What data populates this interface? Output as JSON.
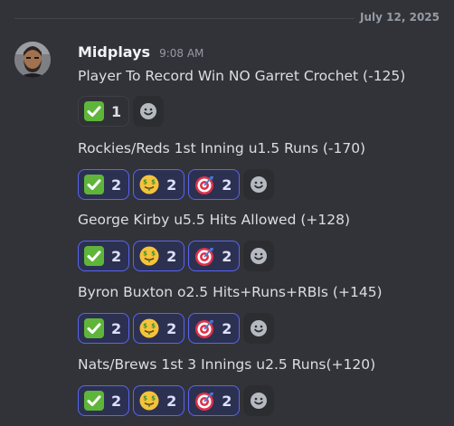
{
  "date_divider": "July 12, 2025",
  "message": {
    "author": "Midplays",
    "time": "9:08 AM"
  },
  "picks": [
    {
      "text": "Player To Record Win NO Garret Crochet (-125)",
      "reactions": [
        {
          "emoji": "check-mark-icon",
          "count": "1",
          "active": false
        }
      ]
    },
    {
      "text": "Rockies/Reds 1st Inning u1.5 Runs (-170)",
      "reactions": [
        {
          "emoji": "check-mark-icon",
          "count": "2",
          "active": true
        },
        {
          "emoji": "money-mouth-face-icon",
          "count": "2",
          "active": true
        },
        {
          "emoji": "direct-hit-icon",
          "count": "2",
          "active": true
        }
      ]
    },
    {
      "text": "George Kirby u5.5 Hits Allowed (+128)",
      "reactions": [
        {
          "emoji": "check-mark-icon",
          "count": "2",
          "active": true
        },
        {
          "emoji": "money-mouth-face-icon",
          "count": "2",
          "active": true
        },
        {
          "emoji": "direct-hit-icon",
          "count": "2",
          "active": true
        }
      ]
    },
    {
      "text": "Byron Buxton o2.5 Hits+Runs+RBIs (+145)",
      "reactions": [
        {
          "emoji": "check-mark-icon",
          "count": "2",
          "active": true
        },
        {
          "emoji": "money-mouth-face-icon",
          "count": "2",
          "active": true
        },
        {
          "emoji": "direct-hit-icon",
          "count": "2",
          "active": true
        }
      ]
    },
    {
      "text": "Nats/Brews 1st 3 Innings u2.5 Runs(+120)",
      "reactions": [
        {
          "emoji": "check-mark-icon",
          "count": "2",
          "active": true
        },
        {
          "emoji": "money-mouth-face-icon",
          "count": "2",
          "active": true
        },
        {
          "emoji": "direct-hit-icon",
          "count": "2",
          "active": true
        }
      ]
    }
  ],
  "colors": {
    "background": "#323339",
    "active_reaction_bg": "#2c3151",
    "active_reaction_border": "#5865f2"
  }
}
